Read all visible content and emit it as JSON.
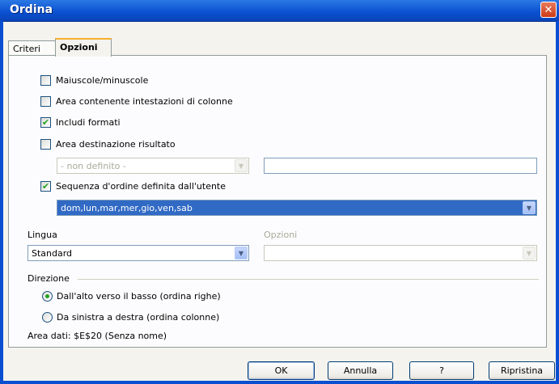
{
  "window": {
    "title": "Ordina",
    "close_glyph": "✕"
  },
  "tabs": [
    {
      "label": "Criteri",
      "active": false
    },
    {
      "label": "Opzioni",
      "active": true
    }
  ],
  "options": {
    "case_sensitive": {
      "label": "Maiuscole/minuscole",
      "checked": false
    },
    "range_has_headers": {
      "label": "Area contenente intestazioni di colonne",
      "checked": false
    },
    "include_formats": {
      "label": "Includi formati",
      "checked": true
    },
    "copy_results": {
      "label": "Area destinazione risultato",
      "checked": false
    },
    "copy_results_combo": {
      "value": "- non definito -",
      "enabled": false
    },
    "copy_results_text": {
      "value": ""
    },
    "custom_sort": {
      "label": "Sequenza d'ordine definita dall'utente",
      "checked": true
    },
    "custom_sort_combo": {
      "value": "dom,lun,mar,mer,gio,ven,sab"
    }
  },
  "language": {
    "label": "Lingua",
    "value": "Standard",
    "options_label": "Opzioni",
    "options_value": ""
  },
  "direction": {
    "label": "Direzione",
    "top_to_bottom": {
      "label": "Dall'alto verso il basso (ordina righe)",
      "checked": true
    },
    "left_to_right": {
      "label": "Da sinistra a destra (ordina colonne)",
      "checked": false
    }
  },
  "data_area": "Area dati: $E$20 (Senza nome)",
  "buttons": {
    "ok": "OK",
    "cancel": "Annulla",
    "help": "?",
    "reset": "Ripristina"
  },
  "icons": {
    "check": "✔",
    "dropdown": "▼"
  },
  "colors": {
    "title_bar": "#0a4fd0",
    "selection": "#316ac5",
    "check": "#21a121"
  }
}
